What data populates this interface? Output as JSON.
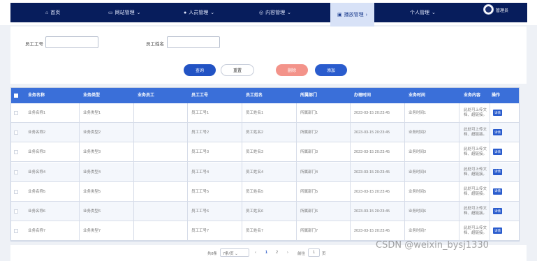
{
  "nav": {
    "home": "首页",
    "items": [
      {
        "label": "网站管理"
      },
      {
        "label": "人员管理"
      },
      {
        "label": "内容管理"
      },
      {
        "label": "播放管理"
      },
      {
        "label": "个人管理"
      }
    ],
    "user": "管理员"
  },
  "search": {
    "emp_id_label": "员工工号",
    "emp_name_label": "员工姓名",
    "emp_id_value": "",
    "emp_name_value": "",
    "query_label": "查询",
    "reset_label": "重置",
    "delete_label": "删除",
    "add_label": "添加"
  },
  "table": {
    "headers": [
      "业务名称",
      "业务类型",
      "业务员工",
      "员工工号",
      "员工姓名",
      "所属部门",
      "办理时间",
      "业务时间",
      "业务内容",
      "操作"
    ],
    "rows": [
      {
        "name": "业务名称1",
        "type": "业务类型1",
        "staff": "",
        "emp_id": "员工工号1",
        "emp_name": "员工姓名1",
        "dept": "所属部门1",
        "time": "2023-03-15 20:23:45",
        "biz_time": "业务时间1",
        "content": "此处可上传文档、超链接。"
      },
      {
        "name": "业务名称2",
        "type": "业务类型2",
        "staff": "",
        "emp_id": "员工工号2",
        "emp_name": "员工姓名2",
        "dept": "所属部门2",
        "time": "2023-03-15 20:23:45",
        "biz_time": "业务时间2",
        "content": "此处可上传文档、超链接。"
      },
      {
        "name": "业务名称3",
        "type": "业务类型3",
        "staff": "",
        "emp_id": "员工工号3",
        "emp_name": "员工姓名3",
        "dept": "所属部门3",
        "time": "2023-03-15 20:23:45",
        "biz_time": "业务时间3",
        "content": "此处可上传文档、超链接。"
      },
      {
        "name": "业务名称4",
        "type": "业务类型4",
        "staff": "",
        "emp_id": "员工工号4",
        "emp_name": "员工姓名4",
        "dept": "所属部门4",
        "time": "2023-03-15 20:23:45",
        "biz_time": "业务时间4",
        "content": "此处可上传文档、超链接。"
      },
      {
        "name": "业务名称5",
        "type": "业务类型5",
        "staff": "",
        "emp_id": "员工工号5",
        "emp_name": "员工姓名5",
        "dept": "所属部门5",
        "time": "2023-03-15 20:23:45",
        "biz_time": "业务时间5",
        "content": "此处可上传文档、超链接。"
      },
      {
        "name": "业务名称6",
        "type": "业务类型6",
        "staff": "",
        "emp_id": "员工工号6",
        "emp_name": "员工姓名6",
        "dept": "所属部门6",
        "time": "2023-03-15 20:23:45",
        "biz_time": "业务时间6",
        "content": "此处可上传文档、超链接。"
      },
      {
        "name": "业务名称7",
        "type": "业务类型7",
        "staff": "",
        "emp_id": "员工工号7",
        "emp_name": "员工姓名7",
        "dept": "所属部门7",
        "time": "2023-03-15 20:23:45",
        "biz_time": "业务时间7",
        "content": "此处可上传文档、超链接。"
      }
    ],
    "detail_label": "详情"
  },
  "pager": {
    "total": "共8条",
    "page_size": "7条/页",
    "prev": "‹",
    "pages": [
      "1",
      "2"
    ],
    "next": "›",
    "goto_label": "前往",
    "goto_value": "1",
    "page_unit": "页"
  },
  "watermark": "CSDN @weixin_bysj1330",
  "colors": {
    "nav_bg": "#071d5c",
    "table_header": "#3a6fd9",
    "primary": "#2253c4",
    "danger": "#f3938a"
  }
}
